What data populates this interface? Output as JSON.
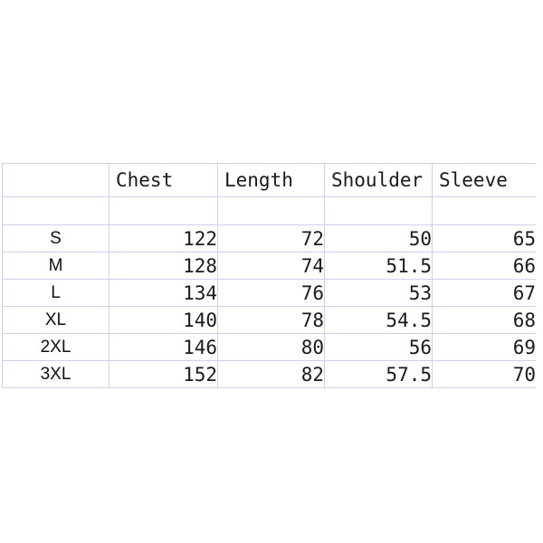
{
  "page": {
    "background_color": "#ffffff",
    "gridline_color": "#ccd0e8",
    "text_color": "#1a1a1a"
  },
  "size_table": {
    "corner_label": "",
    "columns": [
      "Chest",
      "Length",
      "Shoulder",
      "Sleeve"
    ],
    "spacer_row": {
      "size": "",
      "values": [
        "",
        "",
        "",
        ""
      ]
    },
    "rows": [
      {
        "size": "S",
        "values": [
          "122",
          "72",
          "50",
          "65"
        ]
      },
      {
        "size": "M",
        "values": [
          "128",
          "74",
          "51.5",
          "66"
        ]
      },
      {
        "size": "L",
        "values": [
          "134",
          "76",
          "53",
          "67"
        ]
      },
      {
        "size": "XL",
        "values": [
          "140",
          "78",
          "54.5",
          "68"
        ]
      },
      {
        "size": "2XL",
        "values": [
          "146",
          "80",
          "56",
          "69"
        ]
      },
      {
        "size": "3XL",
        "values": [
          "152",
          "82",
          "57.5",
          "70"
        ]
      }
    ]
  }
}
